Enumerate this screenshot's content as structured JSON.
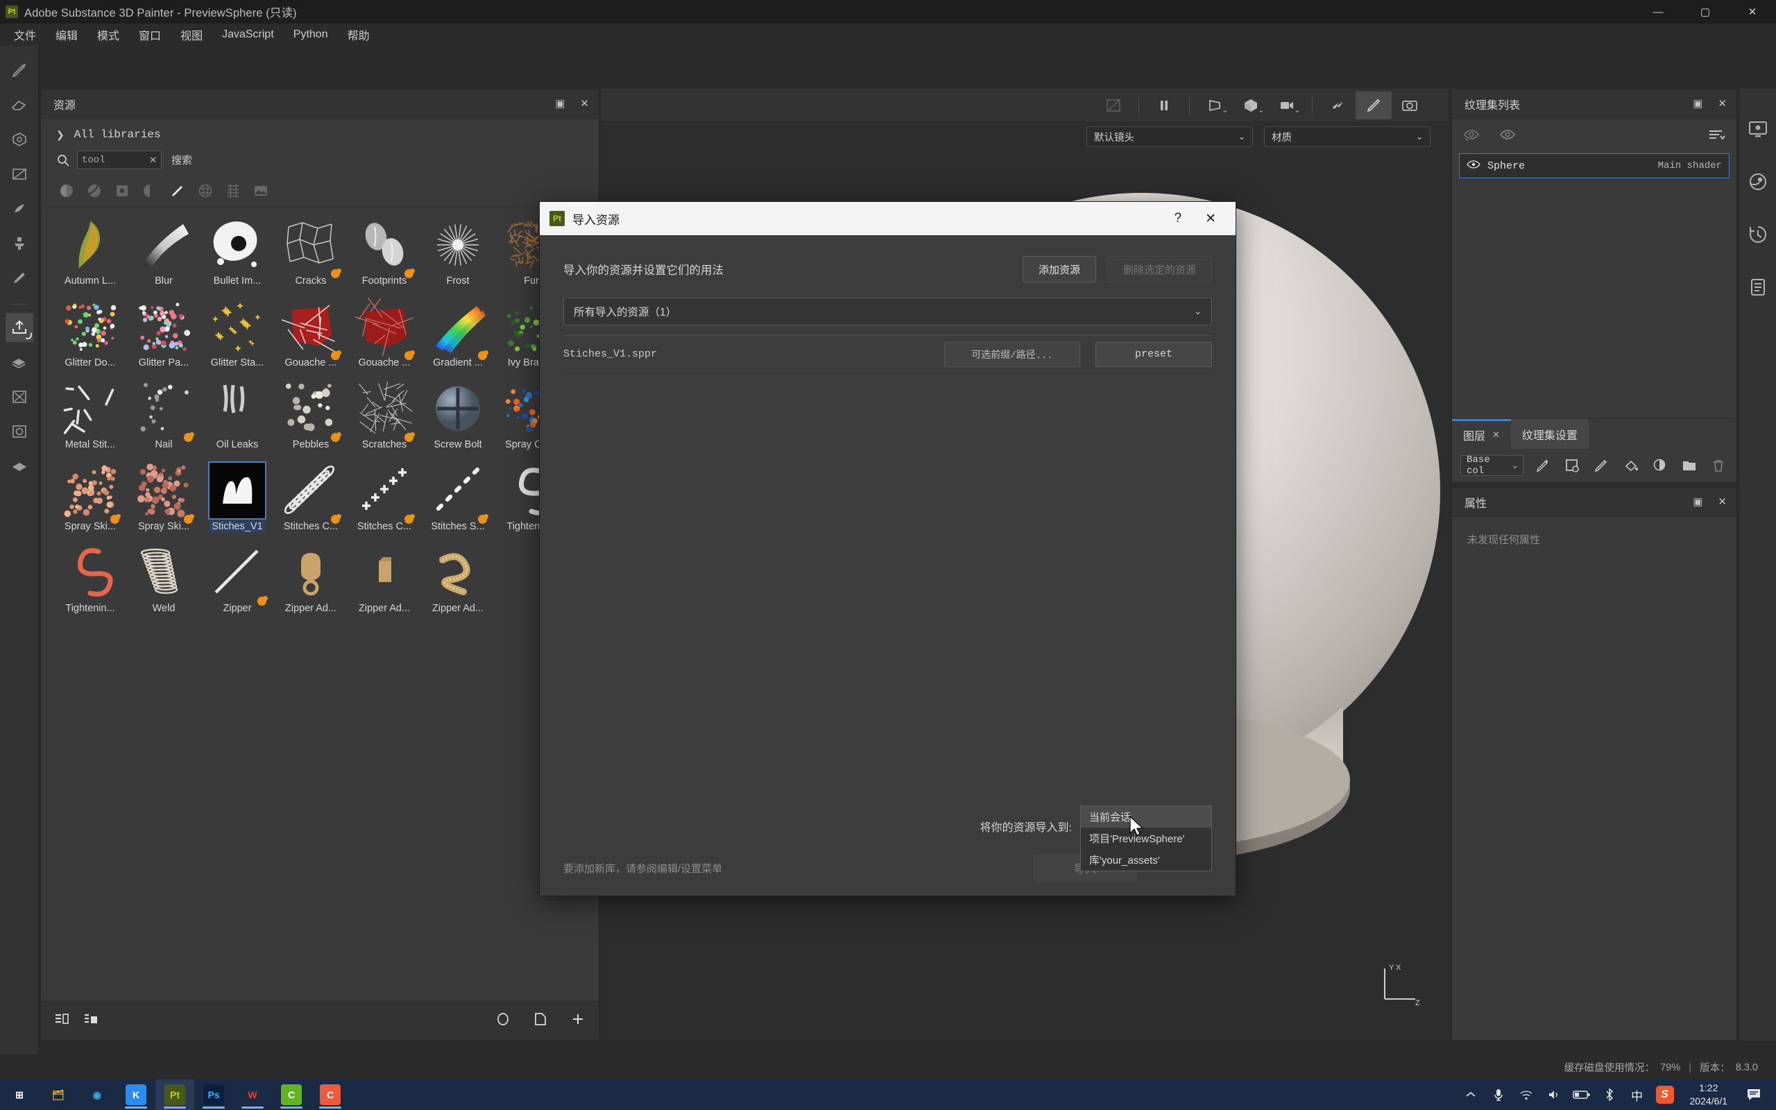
{
  "window": {
    "title": "Adobe Substance 3D Painter - PreviewSphere (只读)",
    "app_badge": "Pt",
    "minimize": "—",
    "maximize": "▢",
    "close": "✕"
  },
  "menubar": {
    "items": [
      "文件",
      "编辑",
      "模式",
      "窗口",
      "视图",
      "JavaScript",
      "Python",
      "帮助"
    ]
  },
  "left_toolbar": {
    "tools": [
      {
        "name": "paint-brush-tool",
        "active": false
      },
      {
        "name": "eraser-tool",
        "active": false
      },
      {
        "name": "projection-tool",
        "active": false
      },
      {
        "name": "polygon-fill-tool",
        "active": false
      },
      {
        "name": "smudge-tool",
        "active": false
      },
      {
        "name": "clone-stamp-tool",
        "active": false
      },
      {
        "name": "material-picker-tool",
        "active": false
      },
      {
        "name": "export-tool",
        "active": true
      },
      {
        "name": "bake-tool",
        "active": false
      },
      {
        "name": "symmetry-tool",
        "active": false
      },
      {
        "name": "render-tool",
        "active": false
      },
      {
        "name": "geometry-tool",
        "active": false
      }
    ]
  },
  "assets_panel": {
    "title": "资源",
    "maximize_icon": "▣",
    "close_icon": "✕",
    "library_label": "All libraries",
    "library_chevron": "❯",
    "search": {
      "value": "tool",
      "clear": "✕",
      "label": "搜索"
    },
    "filters": [
      "material-filter-icon",
      "smart-material-filter-icon",
      "mask-filter-icon",
      "alpha-filter-icon",
      "brush-filter-icon",
      "texture-filter-icon",
      "filter-filter-icon",
      "environment-filter-icon"
    ],
    "grid_toggle_icon": "grid-view-icon",
    "assets": [
      {
        "label": "Autumn L...",
        "kind": "leaf",
        "badge": false
      },
      {
        "label": "Blur",
        "kind": "blur",
        "badge": false
      },
      {
        "label": "Bullet Im...",
        "kind": "splat",
        "badge": false
      },
      {
        "label": "Cracks",
        "kind": "cracks",
        "badge": true
      },
      {
        "label": "Footprints",
        "kind": "foot",
        "badge": true
      },
      {
        "label": "Frost",
        "kind": "frost",
        "badge": false
      },
      {
        "label": "Fur",
        "kind": "fur",
        "badge": false
      },
      {
        "label": "Glitter Do...",
        "kind": "glitterdot",
        "badge": false
      },
      {
        "label": "Glitter Pa...",
        "kind": "glitterpa",
        "badge": false
      },
      {
        "label": "Glitter Sta...",
        "kind": "star",
        "badge": false
      },
      {
        "label": "Gouache ...",
        "kind": "gouache1",
        "badge": true
      },
      {
        "label": "Gouache ...",
        "kind": "gouache2",
        "badge": true
      },
      {
        "label": "Gradient ...",
        "kind": "gradient",
        "badge": true
      },
      {
        "label": "Ivy Branch",
        "kind": "ivy",
        "badge": true
      },
      {
        "label": "Metal Stit...",
        "kind": "metalstitch",
        "badge": false
      },
      {
        "label": "Nail",
        "kind": "nail",
        "badge": true
      },
      {
        "label": "Oil Leaks",
        "kind": "oil",
        "badge": false
      },
      {
        "label": "Pebbles",
        "kind": "pebbles",
        "badge": true
      },
      {
        "label": "Scratches",
        "kind": "scratches",
        "badge": true
      },
      {
        "label": "Screw Bolt",
        "kind": "screw",
        "badge": false
      },
      {
        "label": "Spray Col...",
        "kind": "spraycol",
        "badge": true
      },
      {
        "label": "Spray Ski...",
        "kind": "sprayskin1",
        "badge": true
      },
      {
        "label": "Spray Ski...",
        "kind": "sprayskin2",
        "badge": true
      },
      {
        "label": "Stiches_V1",
        "kind": "stitchsel",
        "badge": false,
        "selected": true
      },
      {
        "label": "Stitches C...",
        "kind": "stitchc1",
        "badge": true
      },
      {
        "label": "Stitches C...",
        "kind": "stitchc2",
        "badge": true
      },
      {
        "label": "Stitches S...",
        "kind": "stitchs",
        "badge": true
      },
      {
        "label": "Tightenin...",
        "kind": "tight1",
        "badge": false
      },
      {
        "label": "Tightenin...",
        "kind": "tight2",
        "badge": false
      },
      {
        "label": "Weld",
        "kind": "weld",
        "badge": false
      },
      {
        "label": "Zipper",
        "kind": "zipper",
        "badge": true
      },
      {
        "label": "Zipper Ad...",
        "kind": "zipperad1",
        "badge": false
      },
      {
        "label": "Zipper Ad...",
        "kind": "zipperad2",
        "badge": false
      },
      {
        "label": "Zipper Ad...",
        "kind": "zipperad3",
        "badge": false
      }
    ],
    "footer_left_icons": [
      "list-view-icon",
      "detail-view-icon"
    ],
    "footer_right_icons": [
      "refresh-icon",
      "new-folder-icon",
      "add-icon"
    ]
  },
  "viewport": {
    "toolbar_icons": [
      "uv-overlay-icon",
      "pause-engine-icon",
      "perspective-camera-icon",
      "shading-mode-icon",
      "camera-view-icon",
      "particle-icon",
      "paint-mode-icon",
      "screenshot-icon"
    ],
    "camera_select": "默认镜头",
    "material_select": "材质",
    "select_caret": "⌄",
    "axis_labels": [
      "Y",
      "X",
      "Z"
    ]
  },
  "texture_set_panel": {
    "title": "纹理集列表",
    "maximize_icon": "▣",
    "close_icon": "✕",
    "tool_icons": [
      "hide-all-icon",
      "eye-icon",
      "sort-list-icon"
    ],
    "rows": [
      {
        "eye": "eye-icon",
        "name": "Sphere",
        "shader": "Main shader"
      }
    ],
    "tabs": [
      {
        "label": "图层",
        "active": true,
        "close": "✕"
      },
      {
        "label": "纹理集设置",
        "active": false
      }
    ],
    "channel_select": "Base col",
    "channel_caret": "⌄",
    "layer_tool_icons": [
      "smart-material-icon",
      "fill-layer-icon",
      "paint-layer-icon",
      "fill-icon",
      "smart-mask-icon",
      "folder-icon",
      "delete-icon"
    ]
  },
  "properties_panel": {
    "title": "属性",
    "maximize_icon": "▣",
    "close_icon": "✕",
    "empty_text": "未发现任何属性"
  },
  "right_rail": {
    "icons": [
      "display-settings-icon",
      "environment-icon",
      "history-icon",
      "log-icon"
    ]
  },
  "statusbar": {
    "cache_label": "缓存磁盘使用情况：",
    "cache_value": "79%",
    "separator": "|",
    "version_label": "版本：",
    "version_value": "8.3.0"
  },
  "import_dialog": {
    "badge": "Pt",
    "title": "导入资源",
    "help_icon": "?",
    "close_icon": "✕",
    "heading": "导入你的资源并设置它们的用法",
    "add_button": "添加资源",
    "remove_button": "删除选定的资源",
    "scope_select": "所有导入的资源（1）",
    "scope_caret": "⌄",
    "asset_rows": [
      {
        "filename": "Stiches_V1.sppr",
        "prefix": "可选前缀/路径...",
        "usage": "preset"
      }
    ],
    "target_label": "将你的资源导入到:",
    "target_value": "",
    "target_caret": "⌄",
    "import_button": "导入",
    "hint": "要添加新库，请参阅编辑/设置菜单",
    "dropdown": {
      "items": [
        {
          "label": "当前会话",
          "mono": false,
          "highlight": true
        },
        {
          "label": "项目'PreviewSphere'",
          "mono": false,
          "highlight": false
        },
        {
          "label": "库'your_assets'",
          "mono": false,
          "highlight": false
        }
      ]
    }
  },
  "taskbar": {
    "apps": [
      {
        "name": "start-button",
        "glyph": "⊞",
        "bg": "transparent",
        "fg": "#ffffff",
        "state": ""
      },
      {
        "name": "file-explorer",
        "glyph": "🗂",
        "bg": "transparent",
        "fg": "#e8b83b",
        "state": ""
      },
      {
        "name": "edge-browser",
        "glyph": "◉",
        "bg": "transparent",
        "fg": "#3fa9d8",
        "state": ""
      },
      {
        "name": "kugou-app",
        "glyph": "K",
        "bg": "#2a8cf0",
        "fg": "#ffffff",
        "state": "run"
      },
      {
        "name": "substance-painter",
        "glyph": "Pt",
        "bg": "#49571b",
        "fg": "#b9d336",
        "state": "active"
      },
      {
        "name": "photoshop",
        "glyph": "Ps",
        "bg": "#0b1f3f",
        "fg": "#35b5f5",
        "state": "run"
      },
      {
        "name": "wps-office",
        "glyph": "W",
        "bg": "transparent",
        "fg": "#e8402a",
        "state": "run"
      },
      {
        "name": "app-green",
        "glyph": "C",
        "bg": "#62b425",
        "fg": "#ffffff",
        "state": "run"
      },
      {
        "name": "app-orange",
        "glyph": "C",
        "bg": "#f05a3c",
        "fg": "#ffffff",
        "state": "run"
      }
    ],
    "tray_icons": [
      "show-hidden-icons",
      "mic-icon",
      "wifi-icon",
      "volume-icon",
      "battery-icon",
      "bluetooth-icon",
      "ime-icon",
      "snipaste-icon"
    ],
    "ime_glyph": "中",
    "clock_time": "1:22",
    "clock_date": "2024/6/1",
    "notification_icon": "notification-icon"
  }
}
